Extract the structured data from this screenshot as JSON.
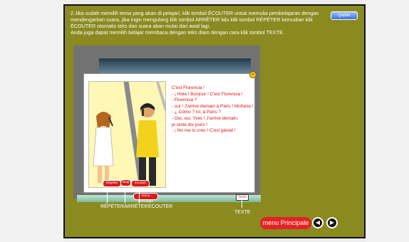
{
  "instructions": {
    "line1": "2.Jika sudah memilih tema yang akan di pelajari, klik tombol ÉCOUTER untuk memulai pembelajaran dengan mendengarkan suara, jika ingin mengulang klik tombol ARRÊTER lalu klik tombol RÉPÉTER kemudian klik ÉCOUTER otomatis teks dan suara akan mulai dari awal lagi.",
    "line2": "Anda juga dapat memilih belajar membaca dengan teks diam dengan cara klik tombol TEXTE."
  },
  "quitter_label": "Quitter",
  "dialog": [
    "C'est  Florencia !",
    "- ¡ Hola ! Bonjour ! C'est Florencia !",
    "- Florencia ?",
    "- oui ! J'arrive demain à Paris ! Moñana !",
    "- ¿ Cómo ? Ici, à Paris ?",
    "- Oui, oui. Yves ! J'arrive demain,",
    "  je reste dix jours !",
    "- ¡ No me lo creo ! C'est génial !"
  ],
  "controls": {
    "repeter": "Répéter",
    "arreter": "Stop",
    "ecouter": "écouter",
    "menu_small": "menu Principale",
    "texte": "Texte"
  },
  "labels": {
    "repeter": "RÉPÉTER",
    "arreter": "ARRÊTER",
    "ecouter": "ÉCOUTER",
    "texte": "TEXTE"
  },
  "footer": {
    "menu_label": "menu Principale",
    "prev_icon": "circle-arrow-left-icon",
    "next_icon": "circle-arrow-right-icon"
  }
}
